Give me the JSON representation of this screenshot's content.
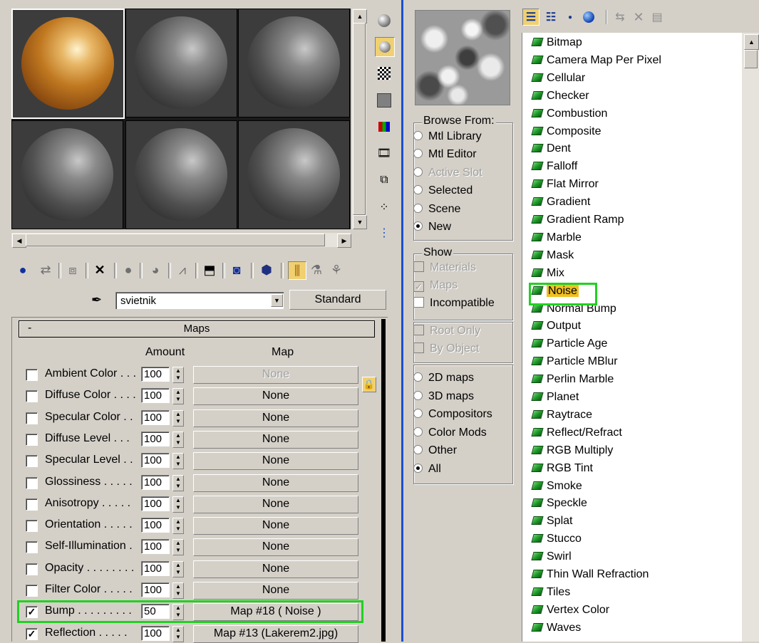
{
  "material_editor": {
    "material_name": "svietnik",
    "material_type": "Standard",
    "maps_rollout_title": "Maps",
    "rollout_collapse": "-",
    "columns": {
      "amount": "Amount",
      "map": "Map"
    },
    "maps": [
      {
        "label": "Ambient Color . . .",
        "checked": false,
        "amount": "100",
        "map": "None",
        "map_disabled": true
      },
      {
        "label": "Diffuse Color . . . .",
        "checked": false,
        "amount": "100",
        "map": "None"
      },
      {
        "label": "Specular Color . .",
        "checked": false,
        "amount": "100",
        "map": "None"
      },
      {
        "label": "Diffuse Level . . .",
        "checked": false,
        "amount": "100",
        "map": "None"
      },
      {
        "label": "Specular Level . .",
        "checked": false,
        "amount": "100",
        "map": "None"
      },
      {
        "label": "Glossiness . . . . .",
        "checked": false,
        "amount": "100",
        "map": "None"
      },
      {
        "label": "Anisotropy . . . . .",
        "checked": false,
        "amount": "100",
        "map": "None"
      },
      {
        "label": "Orientation . . . . .",
        "checked": false,
        "amount": "100",
        "map": "None"
      },
      {
        "label": "Self-Illumination .",
        "checked": false,
        "amount": "100",
        "map": "None"
      },
      {
        "label": "Opacity . . . . . . . .",
        "checked": false,
        "amount": "100",
        "map": "None"
      },
      {
        "label": "Filter Color . . . . .",
        "checked": false,
        "amount": "100",
        "map": "None"
      },
      {
        "label": "Bump . . . . . . . . .",
        "checked": true,
        "amount": "50",
        "map": "Map #18  ( Noise )",
        "highlighted": true
      },
      {
        "label": "Reflection . . . . .",
        "checked": true,
        "amount": "100",
        "map": "Map #13 (Lakerem2.jpg)"
      }
    ],
    "highlight_color": "#22d022"
  },
  "browser": {
    "browse_from": {
      "title": "Browse From:",
      "options": [
        {
          "label": "Mtl Library",
          "selected": false,
          "disabled": false
        },
        {
          "label": "Mtl Editor",
          "selected": false,
          "disabled": false
        },
        {
          "label": "Active Slot",
          "selected": false,
          "disabled": true
        },
        {
          "label": "Selected",
          "selected": false,
          "disabled": false
        },
        {
          "label": "Scene",
          "selected": false,
          "disabled": false
        },
        {
          "label": "New",
          "selected": true,
          "disabled": false
        }
      ]
    },
    "show": {
      "title": "Show",
      "options": [
        {
          "label": "Materials",
          "checked": false,
          "disabled": true
        },
        {
          "label": "Maps",
          "checked": true,
          "disabled": true
        },
        {
          "label": "Incompatible",
          "checked": false,
          "disabled": false
        }
      ]
    },
    "filters": [
      {
        "label": "Root Only",
        "checked": false,
        "disabled": true
      },
      {
        "label": "By Object",
        "checked": false,
        "disabled": true
      }
    ],
    "map_category": {
      "options": [
        {
          "label": "2D maps",
          "selected": false
        },
        {
          "label": "3D maps",
          "selected": false
        },
        {
          "label": "Compositors",
          "selected": false
        },
        {
          "label": "Color Mods",
          "selected": false
        },
        {
          "label": "Other",
          "selected": false
        },
        {
          "label": "All",
          "selected": true
        }
      ]
    },
    "maps_list": [
      "Bitmap",
      "Camera Map Per Pixel",
      "Cellular",
      "Checker",
      "Combustion",
      "Composite",
      "Dent",
      "Falloff",
      "Flat Mirror",
      "Gradient",
      "Gradient Ramp",
      "Marble",
      "Mask",
      "Mix",
      "Noise",
      "Normal Bump",
      "Output",
      "Particle Age",
      "Particle MBlur",
      "Perlin Marble",
      "Planet",
      "Raytrace",
      "Reflect/Refract",
      "RGB Multiply",
      "RGB Tint",
      "Smoke",
      "Speckle",
      "Splat",
      "Stucco",
      "Swirl",
      "Thin Wall Refraction",
      "Tiles",
      "Vertex Color",
      "Waves"
    ],
    "selected_map": "Noise",
    "selected_map_bg": "#f0c020"
  }
}
